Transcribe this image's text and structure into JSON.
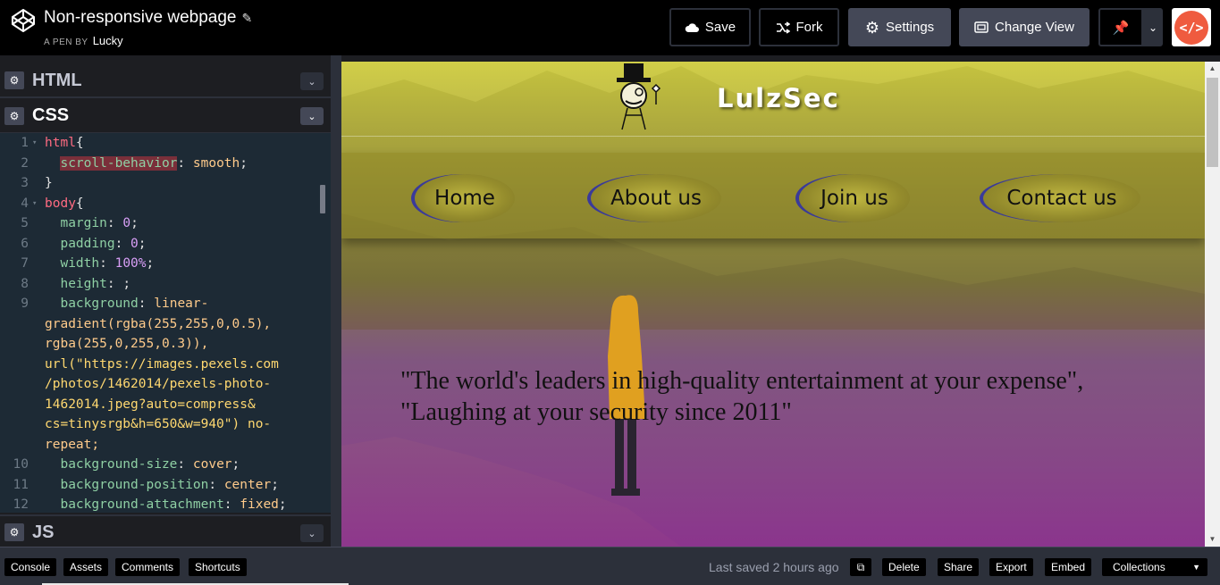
{
  "header": {
    "title": "Non-responsive webpage",
    "edit_icon": "pencil-icon",
    "byline_prefix": "A PEN BY",
    "author": "Lucky",
    "save_label": "Save",
    "fork_label": "Fork",
    "settings_label": "Settings",
    "change_view_label": "Change View",
    "avatar_text": "</>"
  },
  "editor": {
    "html_label": "HTML",
    "css_label": "CSS",
    "js_label": "JS",
    "css_lines": [
      {
        "n": "1",
        "text": "html{"
      },
      {
        "n": "2",
        "text": "  scroll-behavior: smooth;"
      },
      {
        "n": "3",
        "text": "}"
      },
      {
        "n": "4",
        "text": "body{"
      },
      {
        "n": "5",
        "text": "  margin: 0;"
      },
      {
        "n": "6",
        "text": "  padding: 0;"
      },
      {
        "n": "7",
        "text": "  width: 100%;"
      },
      {
        "n": "8",
        "text": "  height: ;"
      },
      {
        "n": "9",
        "text": "  background: linear-"
      },
      {
        "n": "",
        "text": "gradient(rgba(255,255,0,0.5),"
      },
      {
        "n": "",
        "text": "rgba(255,0,255,0.3)),"
      },
      {
        "n": "",
        "text": "url(\"https://images.pexels.com"
      },
      {
        "n": "",
        "text": "/photos/1462014/pexels-photo-"
      },
      {
        "n": "",
        "text": "1462014.jpeg?auto=compress&"
      },
      {
        "n": "",
        "text": "cs=tinysrgb&h=650&w=940\") no-"
      },
      {
        "n": "",
        "text": "repeat;"
      },
      {
        "n": "10",
        "text": "  background-size: cover;"
      },
      {
        "n": "11",
        "text": "  background-position: center;"
      },
      {
        "n": "12",
        "text": "  background-attachment: fixed;"
      }
    ]
  },
  "preview": {
    "logo": "LulzSec",
    "nav": [
      "Home",
      "About us",
      "Join us",
      "Contact us"
    ],
    "quote_line1": "\"The world's leaders in high-quality entertainment at your expense\",",
    "quote_line2": "\"Laughing at your security since 2011\""
  },
  "footer": {
    "console": "Console",
    "assets": "Assets",
    "comments": "Comments",
    "shortcuts": "Shortcuts",
    "last_saved": "Last saved 2 hours ago",
    "delete": "Delete",
    "share": "Share",
    "export": "Export",
    "embed": "Embed",
    "collections": "Collections"
  },
  "colors": {
    "accent_avatar": "#ef5b3f",
    "editor_bg": "#1d2a35",
    "toolbar_bg": "#000000"
  }
}
